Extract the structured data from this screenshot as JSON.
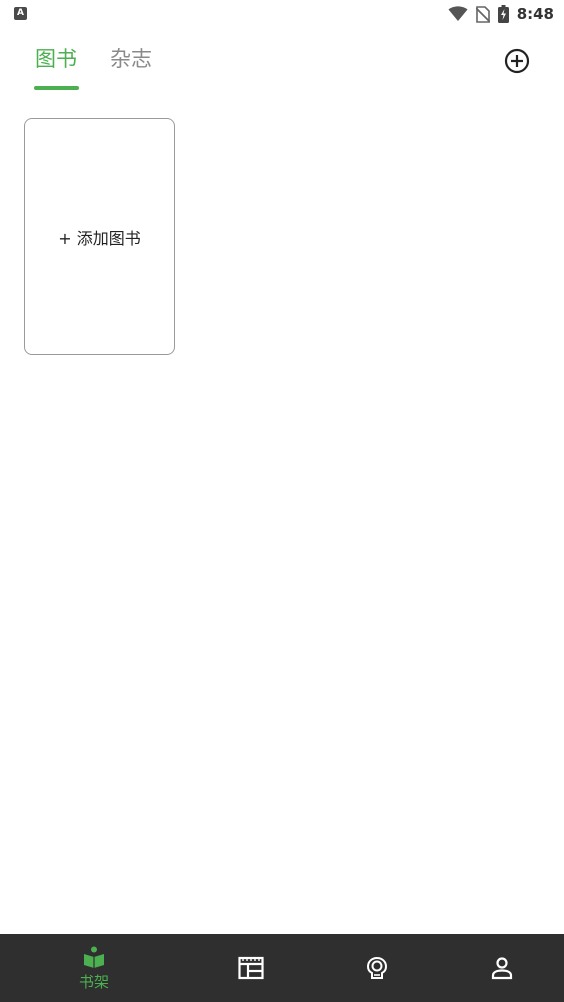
{
  "status_bar": {
    "time": "8:48"
  },
  "tabs": [
    {
      "label": "图书",
      "active": true
    },
    {
      "label": "杂志",
      "active": false
    }
  ],
  "shelf": {
    "add_book_label": "+ 添加图书"
  },
  "bottom_nav": {
    "items": [
      {
        "label": "书架",
        "icon": "bookshelf-icon",
        "active": true
      },
      {
        "label": "",
        "icon": "newspaper-icon",
        "active": false
      },
      {
        "label": "",
        "icon": "discover-icon",
        "active": false
      },
      {
        "label": "",
        "icon": "profile-icon",
        "active": false
      }
    ]
  },
  "colors": {
    "accent": "#4caf50",
    "inactive_tab": "#8a8a8a",
    "nav_background": "#2f2f2f",
    "nav_icon": "#ffffff"
  }
}
